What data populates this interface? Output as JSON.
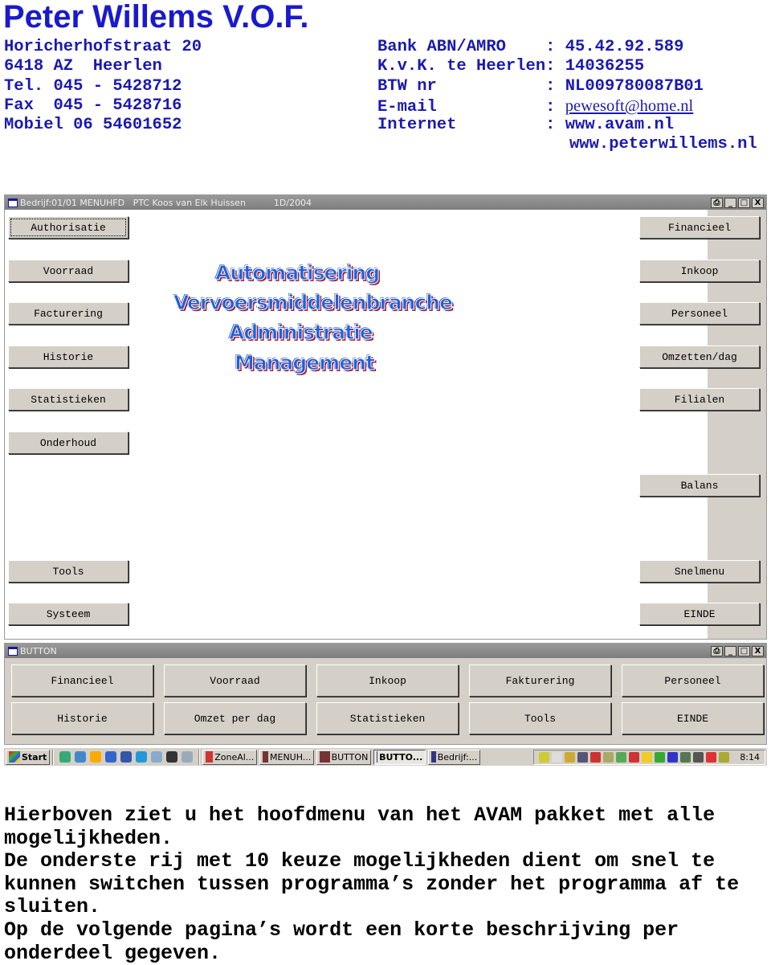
{
  "header": {
    "company": "Peter Willems V.O.F.",
    "left": [
      "Horicherhofstraat 20",
      "6418 AZ  Heerlen",
      "Tel. 045 - 5428712",
      "Fax  045 - 5428716",
      "Mobiel 06 54601652"
    ],
    "right_labels": [
      "Bank ABN/AMRO    : ",
      "K.v.K. te Heerlen: ",
      "BTW nr           : ",
      "E-mail           : ",
      "Internet         : ",
      ""
    ],
    "right_values": [
      "45.42.92.589",
      "14036255",
      "NL009780087B01",
      "pewesoft@home.nl",
      "www.avam.nl",
      "www.peterwillems.nl"
    ]
  },
  "main_window": {
    "title": "Bedrijf:01/01 MENUHFD   PTC Koos van Elk Huissen          1D/2004",
    "controls": [
      "⎙",
      "_",
      "□",
      "X"
    ],
    "left_buttons": [
      "Authorisatie",
      "Voorraad",
      "Facturering",
      "Historie",
      "Statistieken",
      "Onderhoud",
      "Tools",
      "Systeem"
    ],
    "right_buttons": [
      "Financieel",
      "Inkoop",
      "Personeel",
      "Omzetten/dag",
      "Filialen",
      "Balans",
      "Snelmenu",
      "EINDE"
    ],
    "logo_lines": [
      "Automatisering",
      "Vervoersmiddelenbranche",
      "Administratie",
      "Management"
    ]
  },
  "button_window": {
    "title": "BUTTON",
    "controls": [
      "⎙",
      "_",
      "□",
      "X"
    ],
    "rows": [
      [
        "Financieel",
        "Voorraad",
        "Inkoop",
        "Fakturering",
        "Personeel"
      ],
      [
        "Historie",
        "Omzet per dag",
        "Statistieken",
        "Tools",
        "EINDE"
      ]
    ]
  },
  "taskbar": {
    "start": "Start",
    "tasks": [
      "ZoneAl...",
      "MENUH...",
      "BUTTON",
      "BUTTO...",
      "Bedrijf:..."
    ],
    "active_task": 3,
    "clock": "8:14"
  },
  "description": [
    "Hierboven ziet u het hoofdmenu van het AVAM pakket met alle mogelijkheden.",
    "De onderste rij met 10 keuze mogelijkheden dient om snel te kunnen switchen tussen programma’s zonder het programma af te sluiten.",
    "Op de volgende pagina’s wordt een korte beschrijving per onderdeel gegeven."
  ]
}
